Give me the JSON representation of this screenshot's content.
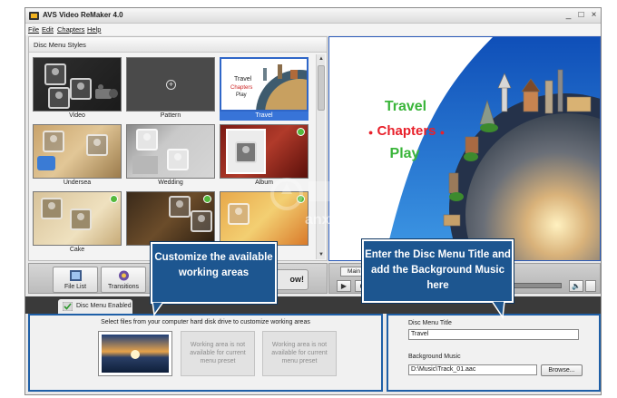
{
  "window": {
    "title": "AVS Video ReMaker 4.0",
    "controls": [
      "_",
      "□",
      "×"
    ]
  },
  "menu": {
    "items": [
      "File",
      "Edit",
      "Chapters",
      "Help"
    ]
  },
  "styles_panel": {
    "header": "Disc Menu Styles",
    "tiles": [
      {
        "label": "Video"
      },
      {
        "label": "Pattern"
      },
      {
        "label": "Travel",
        "selected": true
      },
      {
        "label": "Undersea"
      },
      {
        "label": "Wedding"
      },
      {
        "label": "Album"
      },
      {
        "label": "Cake"
      },
      {
        "label": ""
      },
      {
        "label": ""
      }
    ]
  },
  "preview": {
    "title": "Travel",
    "chapters": "Chapters",
    "play": "Play",
    "colors": {
      "title": "#ffffff",
      "chapters": "#e8212b"
    }
  },
  "toolbar": {
    "file_list": "File List",
    "transitions": "Transitions",
    "now_button": "ow!"
  },
  "player": {
    "tab": "Main"
  },
  "tabstrip": {
    "active_tab": "Disc Menu Enabled"
  },
  "working_areas": {
    "instruction": "Select files from your computer hard disk drive to customize working areas",
    "slot2": "Working area is not available for current menu preset",
    "slot3": "Working area is not available for current menu preset"
  },
  "disc_menu": {
    "title_label": "Disc Menu Title",
    "title_value": "Travel",
    "music_label": "Background Music",
    "music_value": "D:\\Music\\Track_01.aac",
    "browse_label": "Browse..."
  },
  "callouts": {
    "left": "Customize the available working areas",
    "right": "Enter the Disc Menu Title and add the Background Music here"
  },
  "watermark": "anxz.com"
}
